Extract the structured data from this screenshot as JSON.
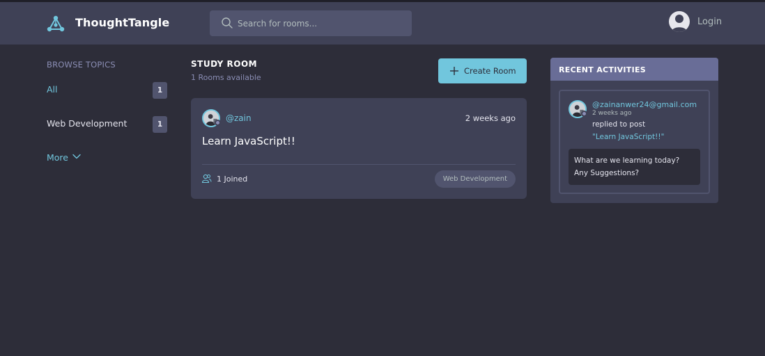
{
  "brand": {
    "name": "ThoughtTangle",
    "logo_icon": "network-icon"
  },
  "search": {
    "placeholder": "Search for rooms..."
  },
  "header": {
    "login_label": "Login"
  },
  "sidebar": {
    "title": "BROWSE TOPICS",
    "topics": [
      {
        "label": "All",
        "count": "1"
      },
      {
        "label": "Web Development",
        "count": "1"
      }
    ],
    "more_label": "More"
  },
  "main": {
    "heading": "STUDY ROOM",
    "rooms_available": "1 Rooms available",
    "create_label": "Create Room",
    "rooms": [
      {
        "host": "@zain",
        "time": "2 weeks ago",
        "title": "Learn JavaScript!!",
        "joined": "1 Joined",
        "topic": "Web Development"
      }
    ]
  },
  "activity": {
    "title": "RECENT ACTIVITIES",
    "items": [
      {
        "user": "@zainanwer24@gmail.com",
        "time": "2 weeks ago",
        "action": "replied to post",
        "post": "\"Learn JavaScript!!\"",
        "body": "What are we learning today? Any Suggestions?"
      }
    ]
  },
  "colors": {
    "background": "#2d2d39",
    "surface": "#3f4156",
    "accent": "#71c6dd",
    "header_panel": "#696d97"
  }
}
